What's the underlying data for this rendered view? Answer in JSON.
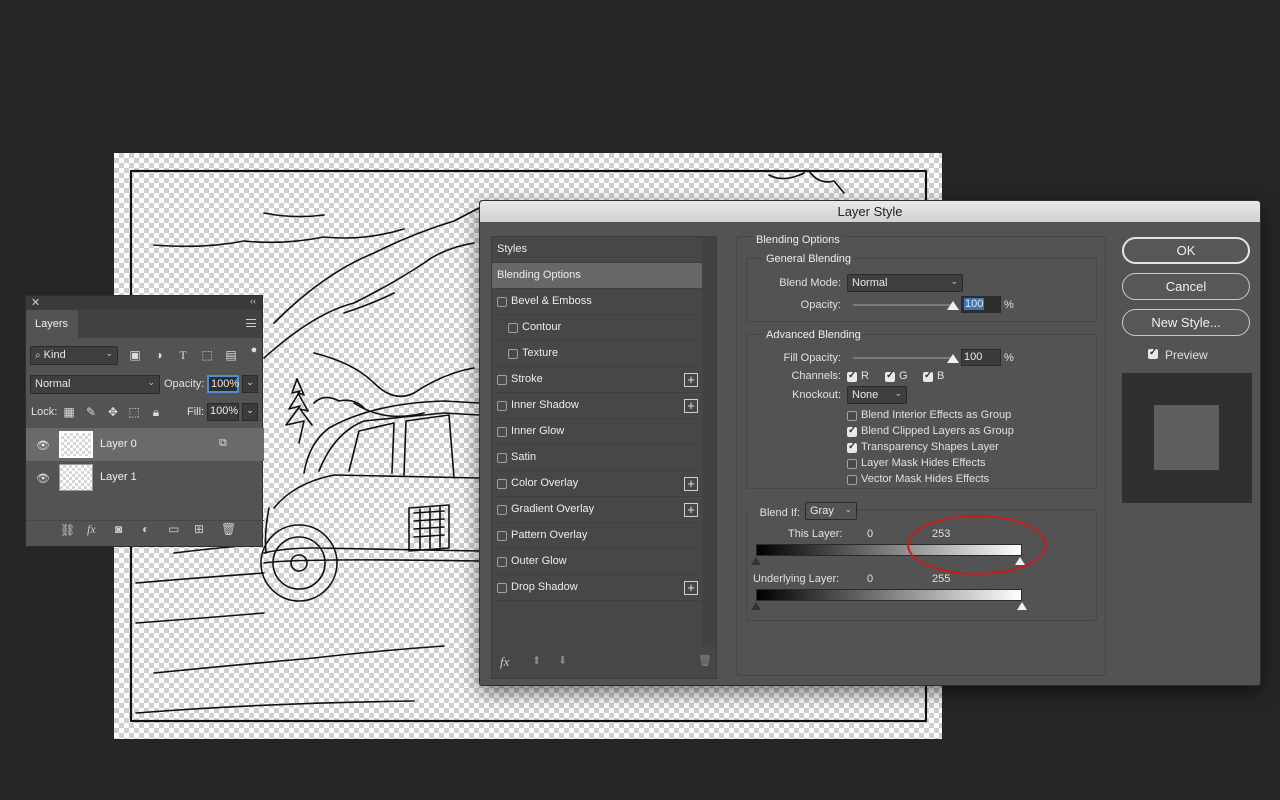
{
  "layers_panel": {
    "close_glyph": "✕",
    "collapse_glyph": "‹‹",
    "tab_label": "Layers",
    "filter_kind": "Kind",
    "blend_mode": "Normal",
    "opacity_label": "Opacity:",
    "opacity_value": "100%",
    "lock_label": "Lock:",
    "fill_label": "Fill:",
    "fill_value": "100%",
    "layers": [
      {
        "name": "Layer 0",
        "active": true
      },
      {
        "name": "Layer 1",
        "active": false
      }
    ]
  },
  "dialog": {
    "title": "Layer Style",
    "styles_header": "Styles",
    "styles": [
      {
        "label": "Blending Options",
        "checkbox": false,
        "indent": false,
        "plus": false,
        "active": true
      },
      {
        "label": "Bevel & Emboss",
        "checkbox": true,
        "indent": false,
        "plus": false
      },
      {
        "label": "Contour",
        "checkbox": true,
        "indent": true,
        "plus": false
      },
      {
        "label": "Texture",
        "checkbox": true,
        "indent": true,
        "plus": false
      },
      {
        "label": "Stroke",
        "checkbox": true,
        "indent": false,
        "plus": true
      },
      {
        "label": "Inner Shadow",
        "checkbox": true,
        "indent": false,
        "plus": true
      },
      {
        "label": "Inner Glow",
        "checkbox": true,
        "indent": false,
        "plus": false
      },
      {
        "label": "Satin",
        "checkbox": true,
        "indent": false,
        "plus": false
      },
      {
        "label": "Color Overlay",
        "checkbox": true,
        "indent": false,
        "plus": true
      },
      {
        "label": "Gradient Overlay",
        "checkbox": true,
        "indent": false,
        "plus": true
      },
      {
        "label": "Pattern Overlay",
        "checkbox": true,
        "indent": false,
        "plus": false
      },
      {
        "label": "Outer Glow",
        "checkbox": true,
        "indent": false,
        "plus": false
      },
      {
        "label": "Drop Shadow",
        "checkbox": true,
        "indent": false,
        "plus": true
      }
    ],
    "fx_label": "fx",
    "blending_options_title": "Blending Options",
    "general_blending_title": "General Blending",
    "blend_mode_label": "Blend Mode:",
    "blend_mode_value": "Normal",
    "opacity_label": "Opacity:",
    "opacity_value": "100",
    "percent": "%",
    "opacity_level": 1.0,
    "advanced_blending_title": "Advanced Blending",
    "fill_opacity_label": "Fill Opacity:",
    "fill_opacity_value": "100",
    "fill_opacity_level": 1.0,
    "channels_label": "Channels:",
    "channels": [
      {
        "label": "R",
        "checked": true
      },
      {
        "label": "G",
        "checked": true
      },
      {
        "label": "B",
        "checked": true
      }
    ],
    "knockout_label": "Knockout:",
    "knockout_value": "None",
    "advanced_options": [
      {
        "label": "Blend Interior Effects as Group",
        "checked": false
      },
      {
        "label": "Blend Clipped Layers as Group",
        "checked": true
      },
      {
        "label": "Transparency Shapes Layer",
        "checked": true
      },
      {
        "label": "Layer Mask Hides Effects",
        "checked": false
      },
      {
        "label": "Vector Mask Hides Effects",
        "checked": false
      }
    ],
    "blend_if_label": "Blend If:",
    "blend_if_value": "Gray",
    "this_layer_label": "This Layer:",
    "this_layer_low": "0",
    "this_layer_high": "253",
    "underlying_label": "Underlying Layer:",
    "underlying_low": "0",
    "underlying_high": "255",
    "buttons": {
      "ok": "OK",
      "cancel": "Cancel",
      "new_style": "New Style..."
    },
    "preview_label": "Preview",
    "preview_checked": true
  },
  "colors": {
    "annotation": "#cc1a1a",
    "focus": "#4a90d9"
  }
}
